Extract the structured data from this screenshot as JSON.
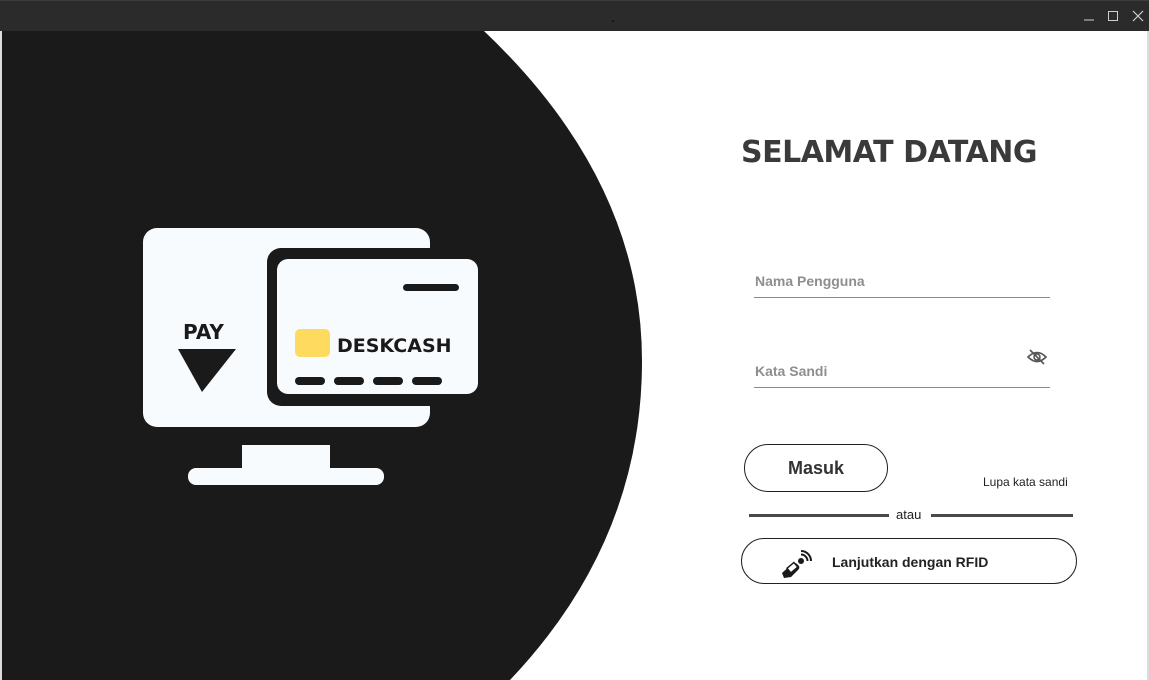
{
  "window": {
    "minimize_icon": "minimize-icon",
    "maximize_icon": "maximize-icon",
    "close_icon": "close-icon"
  },
  "brand": {
    "pay_label": "PAY",
    "card_label": "DESKCASH",
    "chip_color": "#FEDA5E",
    "dark_color": "#1A1A1A",
    "light_color": "#F8FBFD"
  },
  "login": {
    "title": "SELAMAT DATANG",
    "username_placeholder": "Nama Pengguna",
    "username_value": "",
    "password_placeholder": "Kata Sandi",
    "password_value": "",
    "password_toggle_icon": "eye-off-icon",
    "submit_label": "Masuk",
    "forgot_label": "Lupa kata sandi",
    "divider_label": "atau",
    "rfid_label": "Lanjutkan dengan RFID",
    "rfid_icon": "rfid-tap-icon"
  }
}
